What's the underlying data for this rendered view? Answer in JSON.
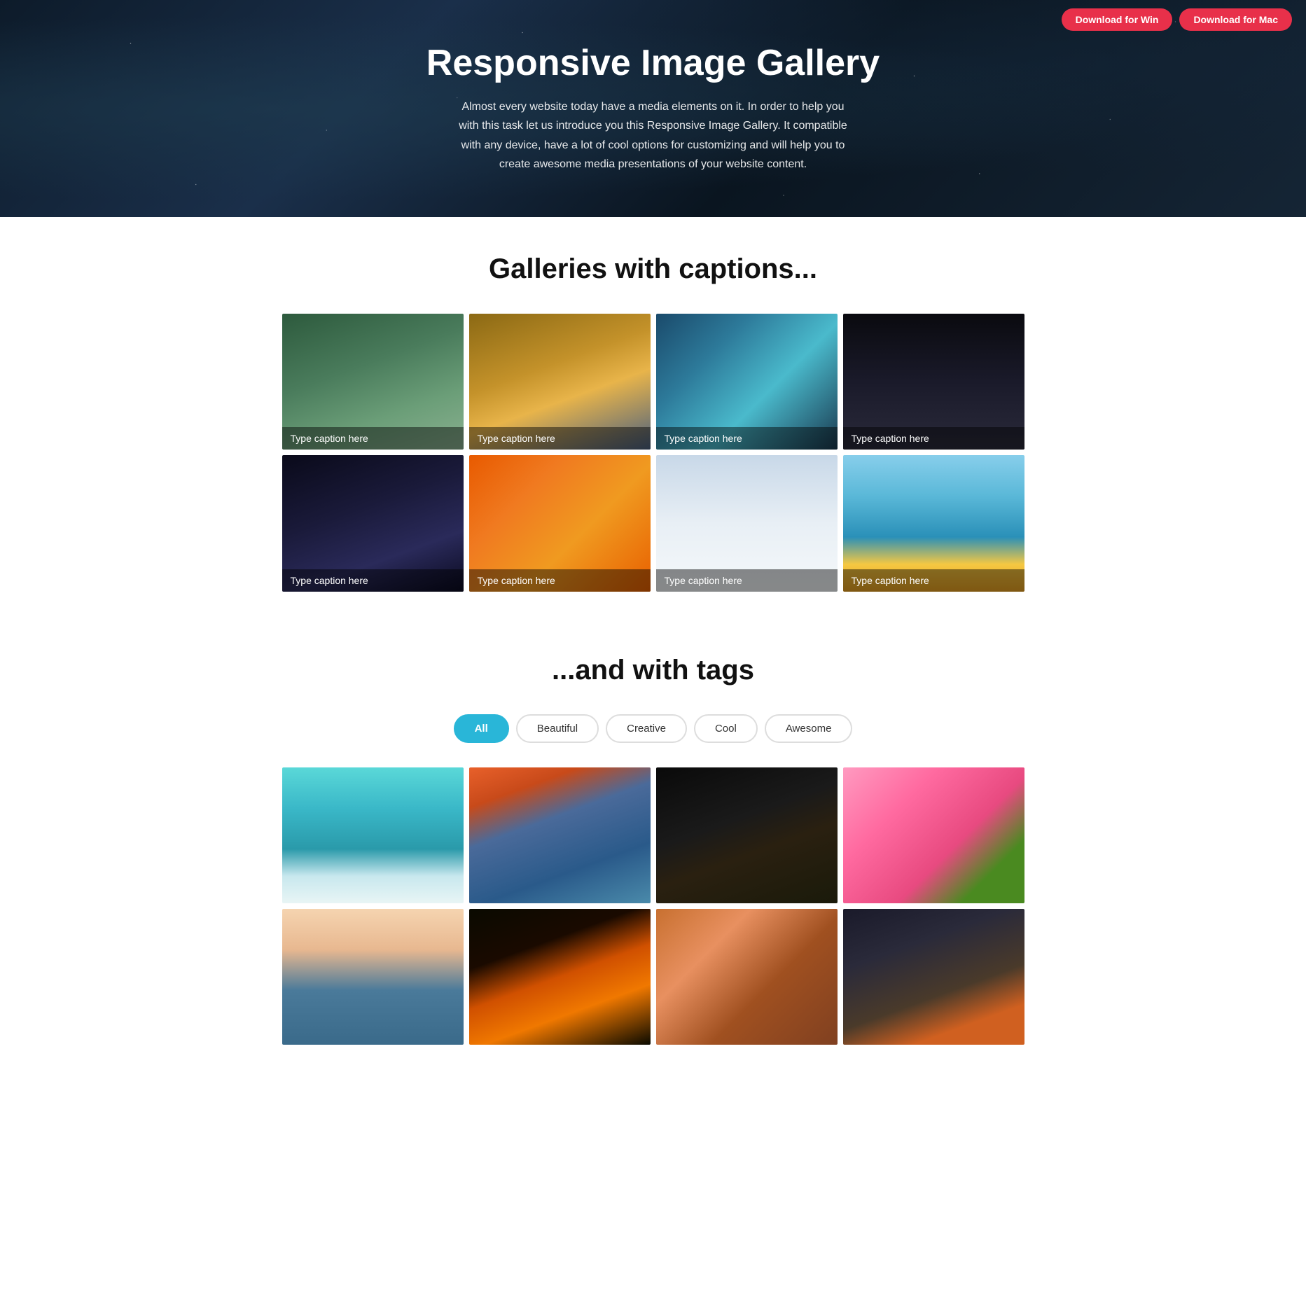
{
  "nav": {
    "download_win": "Download for Win",
    "download_mac": "Download for Mac"
  },
  "hero": {
    "title": "Responsive Image Gallery",
    "description": "Almost every website today have a media elements on it. In order to help you with this task let us introduce you this Responsive Image Gallery. It compatible with any device, have a lot of cool options for customizing and will help you to create awesome media presentations of your website content."
  },
  "captions_section": {
    "title": "Galleries with captions..."
  },
  "caption_gallery": [
    {
      "caption": "Type caption here",
      "img_class": "img-forest"
    },
    {
      "caption": "Type caption here",
      "img_class": "img-city"
    },
    {
      "caption": "Type caption here",
      "img_class": "img-peacock"
    },
    {
      "caption": "Type caption here",
      "img_class": "img-dock"
    },
    {
      "caption": "Type caption here",
      "img_class": "img-house-night"
    },
    {
      "caption": "Type caption here",
      "img_class": "img-oranges"
    },
    {
      "caption": "Type caption here",
      "img_class": "img-snow"
    },
    {
      "caption": "Type caption here",
      "img_class": "img-skyline"
    }
  ],
  "tags_section": {
    "title": "...and with tags"
  },
  "tag_filters": [
    {
      "label": "All",
      "active": true
    },
    {
      "label": "Beautiful",
      "active": false
    },
    {
      "label": "Creative",
      "active": false
    },
    {
      "label": "Cool",
      "active": false
    },
    {
      "label": "Awesome",
      "active": false
    }
  ],
  "tag_gallery": [
    {
      "img_class": "img-lake-teal"
    },
    {
      "img_class": "img-mountain-sunset"
    },
    {
      "img_class": "img-dark-city"
    },
    {
      "img_class": "img-cherry"
    },
    {
      "img_class": "img-pier"
    },
    {
      "img_class": "img-fire"
    },
    {
      "img_class": "img-bokeh"
    },
    {
      "img_class": "img-rock"
    }
  ]
}
